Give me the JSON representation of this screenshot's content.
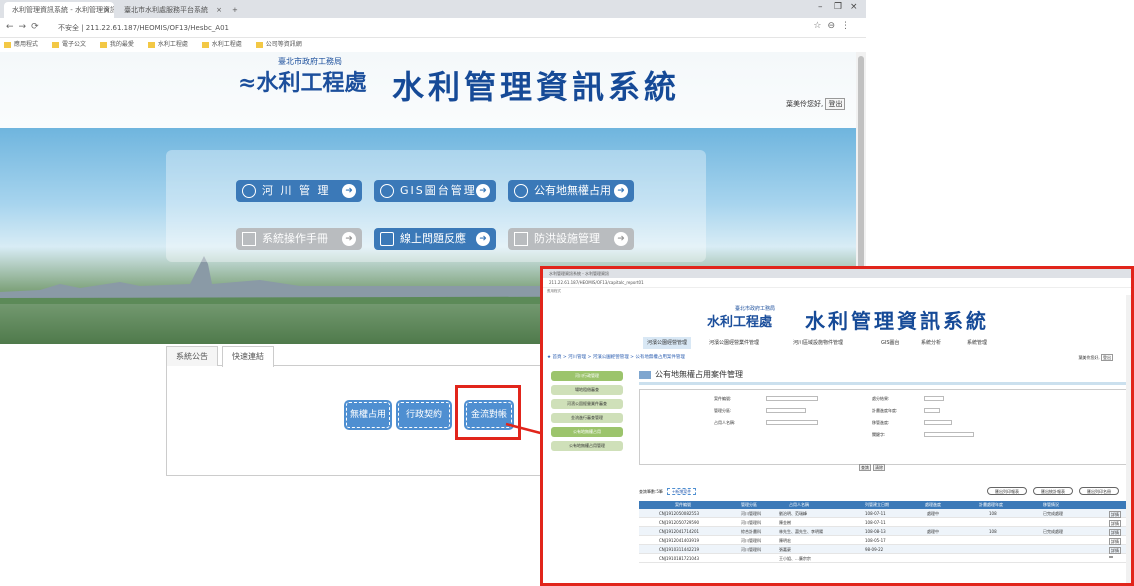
{
  "browser": {
    "tab1": "水利管理資訊系統 - 水利管理資訊",
    "tab2": "臺北市水利處服務平台系統",
    "new_tab": "+",
    "url": "不安全 | 211.22.61.187/HEOMIS/OF13/Hesbc_A01",
    "bookmarks": [
      "應用程式",
      "電子公文",
      "我的最愛",
      "水利工程處",
      "水利工程處",
      "公司等資訊網"
    ]
  },
  "header": {
    "logo_sub": "臺北市政府工務局",
    "logo_main": "水利工程處",
    "system_title": "水利管理資訊系統",
    "greeting": "葉美伶您好,",
    "logout": "登出"
  },
  "quick_buttons": [
    {
      "label": "河 川 管 理",
      "icon": "lightbulb-icon"
    },
    {
      "label": "GIS圖台管理",
      "icon": "globe-icon"
    },
    {
      "label": "公有地無權占用",
      "icon": "gear-icon"
    },
    {
      "label": "系統操作手冊",
      "icon": "book-icon"
    },
    {
      "label": "線上問題反應",
      "icon": "chat-icon"
    },
    {
      "label": "防洪設施管理",
      "icon": "chart-icon"
    }
  ],
  "tabs": {
    "announce": "系統公告",
    "links": "快速連結"
  },
  "links": {
    "l1": "無權占用",
    "l2": "行政契約",
    "l3": "金流對帳"
  },
  "inset": {
    "tab": "水利管理資訊系統 - 水利管理資訊",
    "url": "211.22.61.187/HEOMIS/OF13/capitalc_report01",
    "logo_sub": "臺北市政府工務局",
    "logo_main": "水利工程處",
    "title": "水利管理資訊系統",
    "nav": [
      "河濱公園經營管理",
      "河濱公園經營業件管理",
      "河川區域設施物件管理",
      "GIS圖台",
      "系統分析",
      "系統管理"
    ],
    "breadcrumb": "★ 首頁 > 河川管理 > 河濱公園經營管理 > 公有地無權占用案件管理",
    "user": "葉美伶您好,",
    "logout": "登出",
    "side": [
      "河川行政管理",
      "場地租借審查",
      "河濱公園經營業件審查",
      "金流進行審查管理",
      "公有地無權占用",
      "公有地無權占用管理"
    ],
    "heading": "公有地無權占用案件管理",
    "form_labels": [
      "案件編號:",
      "管理分區:",
      "占用人名稱:",
      "處分結果:",
      "計畫進度年度:",
      "移管進度:",
      "關鍵字:"
    ],
    "search": "查詢",
    "clear": "清除",
    "count": "查詢筆數:5筆",
    "add": "+新增案件",
    "rbtns": [
      "匯出列印報表",
      "匯出統計報表",
      "匯出列印名冊"
    ],
    "cols": [
      "案件編號",
      "管理分區",
      "占用人名稱",
      "列管建立日期",
      "處理進度",
      "計畫處理年度",
      "移管情況",
      ""
    ],
    "rows": [
      [
        "CNJ1912050082553",
        "河川管理科",
        "劉治明、范瑞峰",
        "108-07-11",
        "處理中",
        "108",
        "已完成處理",
        "詳情"
      ],
      [
        "CNJ1912050729590",
        "河川管理科",
        "陳金樹",
        "108-07-11",
        "",
        "",
        "",
        "詳情"
      ],
      [
        "CNJ1912041714201",
        "綜合計畫科",
        "林先生、蕭先生、李明陽",
        "108-08-13",
        "處理中",
        "108",
        "已完成處理",
        "詳情"
      ],
      [
        "CNJ1912041403919",
        "河川管理科",
        "陳明宏",
        "108-05-17",
        "",
        "",
        "",
        "詳情"
      ],
      [
        "CNJ1910311442219",
        "河川管理科",
        "張嘉豪",
        "98-09-22",
        "",
        "",
        "",
        "詳情"
      ],
      [
        "CNJ1910181721043",
        "",
        "王小姐、...廣宗宗",
        "",
        "",
        "",
        "",
        ""
      ]
    ]
  }
}
